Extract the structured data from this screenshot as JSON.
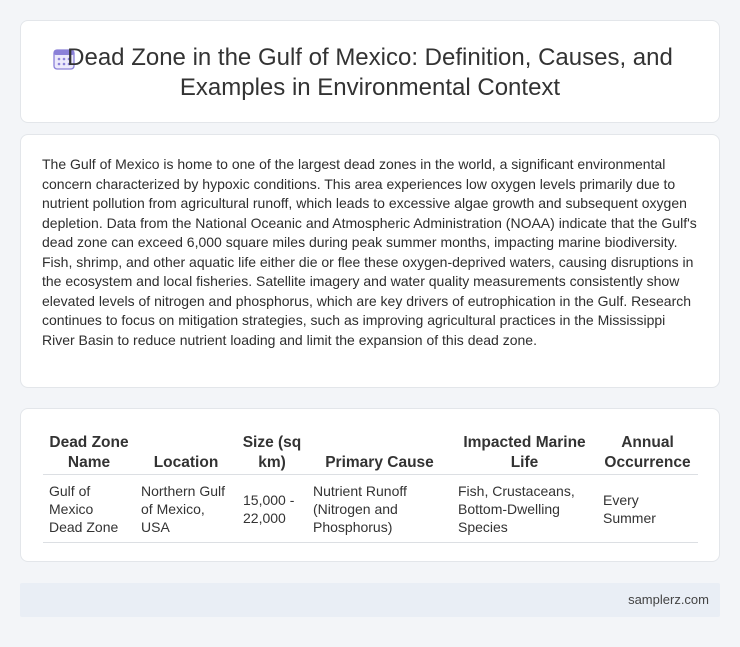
{
  "header": {
    "icon": "calendar-grid-icon",
    "title": "Dead Zone in the Gulf of Mexico: Definition, Causes, and Examples in Environmental Context"
  },
  "body": {
    "paragraph": "The Gulf of Mexico is home to one of the largest dead zones in the world, a significant environmental concern characterized by hypoxic conditions. This area experiences low oxygen levels primarily due to nutrient pollution from agricultural runoff, which leads to excessive algae growth and subsequent oxygen depletion. Data from the National Oceanic and Atmospheric Administration (NOAA) indicate that the Gulf's dead zone can exceed 6,000 square miles during peak summer months, impacting marine biodiversity. Fish, shrimp, and other aquatic life either die or flee these oxygen-deprived waters, causing disruptions in the ecosystem and local fisheries. Satellite imagery and water quality measurements consistently show elevated levels of nitrogen and phosphorus, which are key drivers of eutrophication in the Gulf. Research continues to focus on mitigation strategies, such as improving agricultural practices in the Mississippi River Basin to reduce nutrient loading and limit the expansion of this dead zone."
  },
  "table": {
    "headers": [
      "Dead Zone Name",
      "Location",
      "Size (sq km)",
      "Primary Cause",
      "Impacted Marine Life",
      "Annual Occurrence"
    ],
    "rows": [
      [
        "Gulf of Mexico Dead Zone",
        "Northern Gulf of Mexico, USA",
        "15,000 - 22,000",
        "Nutrient Runoff (Nitrogen and Phosphorus)",
        "Fish, Crustaceans, Bottom-Dwelling Species",
        "Every Summer"
      ]
    ]
  },
  "footer": {
    "site": "samplerz.com"
  },
  "colors": {
    "icon_accent": "#7b6fd6",
    "footer_bg": "#e9eef5"
  }
}
